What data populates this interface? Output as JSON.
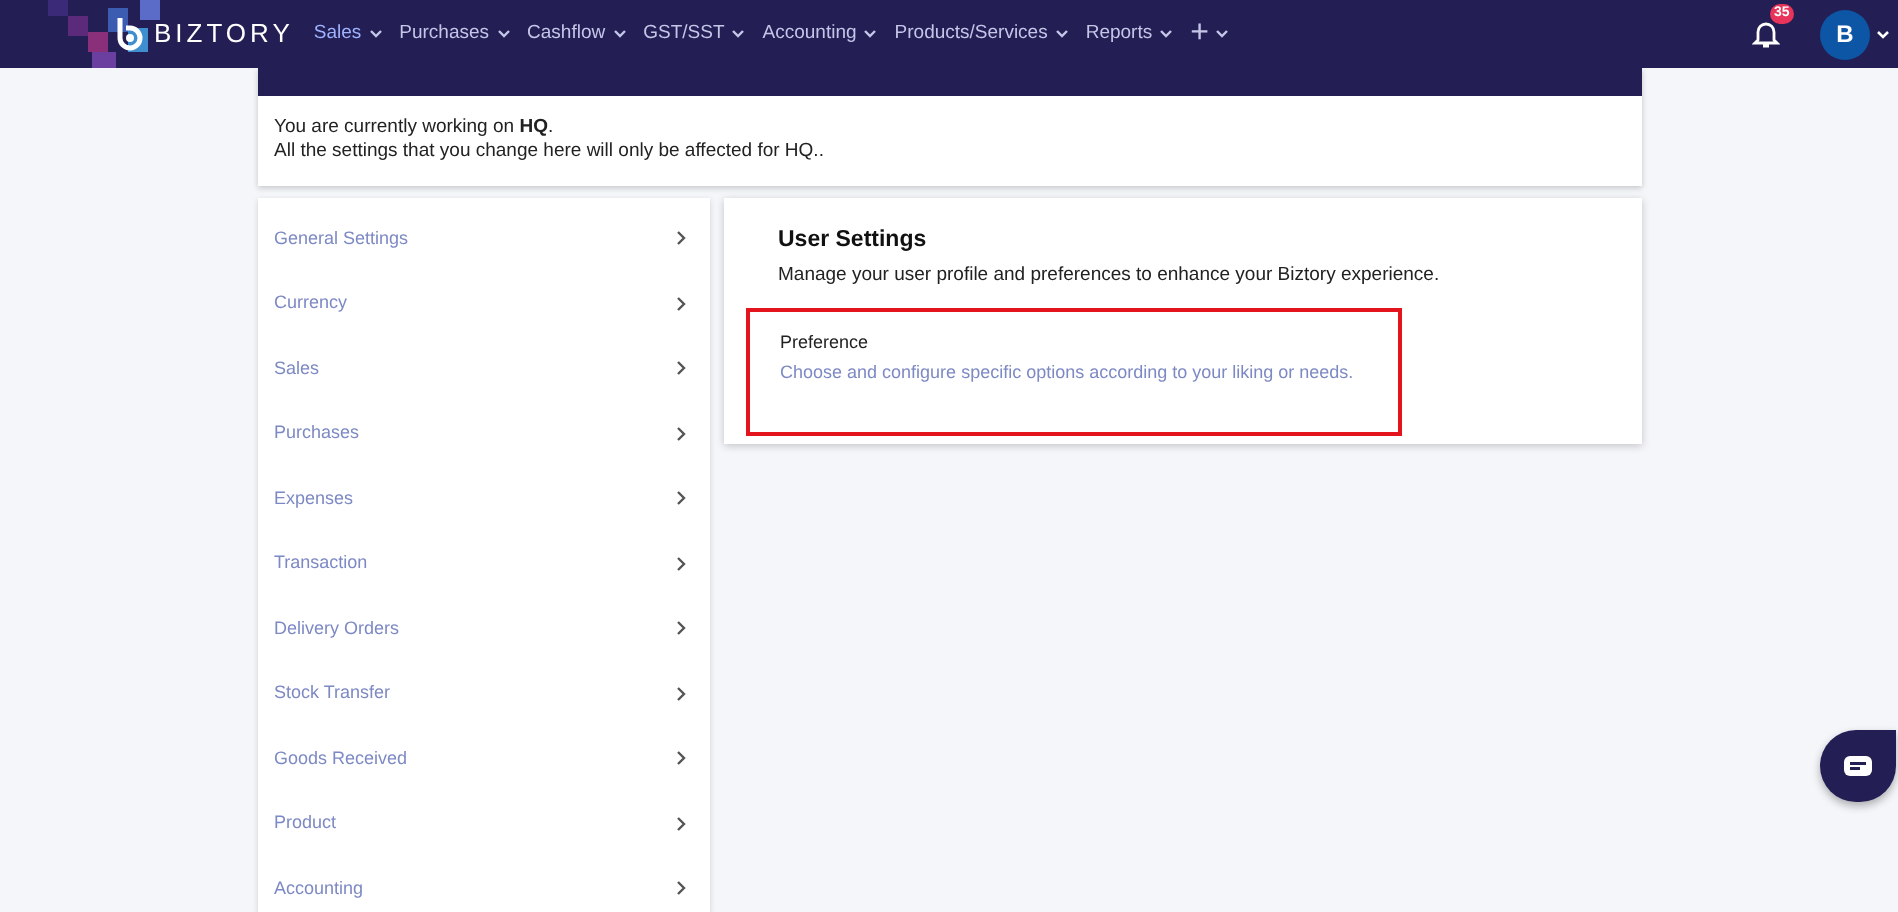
{
  "nav": {
    "brand": "BIZTORY",
    "menus": [
      {
        "label": "Sales",
        "selected": true
      },
      {
        "label": "Purchases",
        "selected": false
      },
      {
        "label": "Cashflow",
        "selected": false
      },
      {
        "label": "GST/SST",
        "selected": false
      },
      {
        "label": "Accounting",
        "selected": false
      },
      {
        "label": "Products/Services",
        "selected": false
      },
      {
        "label": "Reports",
        "selected": false
      }
    ],
    "add_menu": "+",
    "notification_count": "35",
    "avatar": "B"
  },
  "notice": {
    "line1": "You are currently working on **HQ**.",
    "line2": "All the settings that you change here will only be affected for HQ.."
  },
  "sidebar": {
    "items": [
      "General Settings",
      "Currency",
      "Sales",
      "Purchases",
      "Expenses",
      "Transaction",
      "Delivery Orders",
      "Stock Transfer",
      "Goods Received",
      "Product",
      "Accounting"
    ]
  },
  "user_settings": {
    "title": "User Settings",
    "description": "Manage your user profile and preferences to enhance your Biztory experience.",
    "options": [
      {
        "title": "Preference",
        "description": "Choose and configure specific options according to your liking or needs.",
        "highlighted": true
      }
    ]
  }
}
